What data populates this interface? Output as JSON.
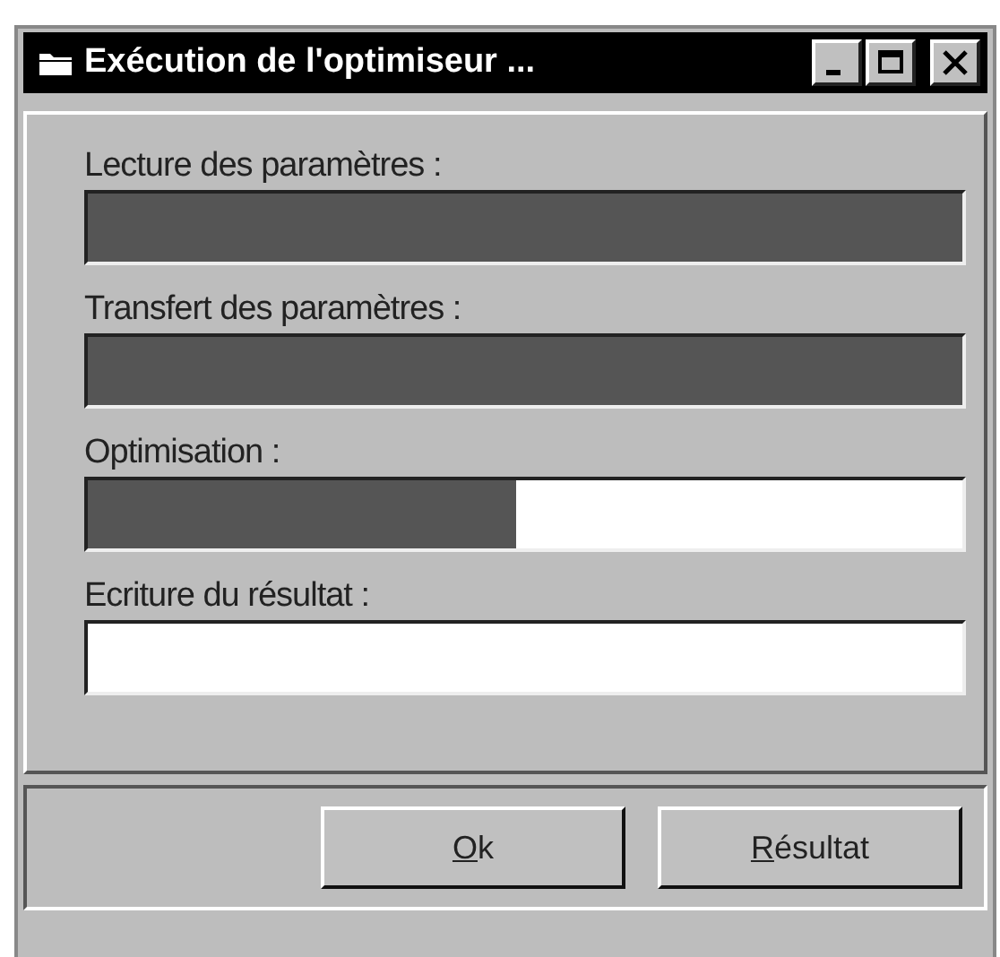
{
  "window": {
    "title": "Exécution de l'optimiseur ..."
  },
  "steps": [
    {
      "label": "Lecture des paramètres :",
      "level": 1
    },
    {
      "label": "Transfert des paramètres :",
      "level": 1
    },
    {
      "label": "Optimisation :",
      "level": 0.49
    },
    {
      "label": "Ecriture du résultat :",
      "level": 0
    }
  ],
  "buttons": [
    "Ok",
    "Résultat"
  ]
}
